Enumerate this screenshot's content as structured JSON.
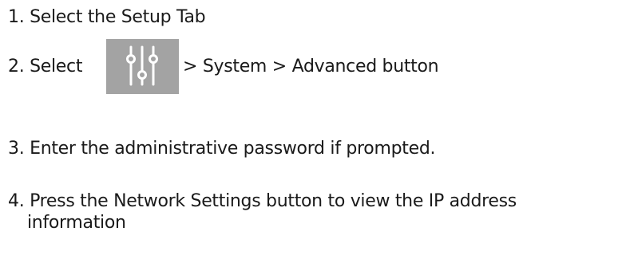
{
  "steps": [
    {
      "number": "1.",
      "text": "Select the Setup Tab"
    },
    {
      "number": "2.",
      "before_icon": "Select",
      "icon": "settings-sliders-icon",
      "after_icon": "> System > Advanced button"
    },
    {
      "number": "3.",
      "text": "Enter the administrative password if prompted."
    },
    {
      "number": "4.",
      "line1": "Press the Network Settings button to view the IP address",
      "line2": "information"
    }
  ],
  "colors": {
    "text": "#1a1a1a",
    "icon_background": "#a3a3a3",
    "icon_foreground": "#ffffff"
  }
}
